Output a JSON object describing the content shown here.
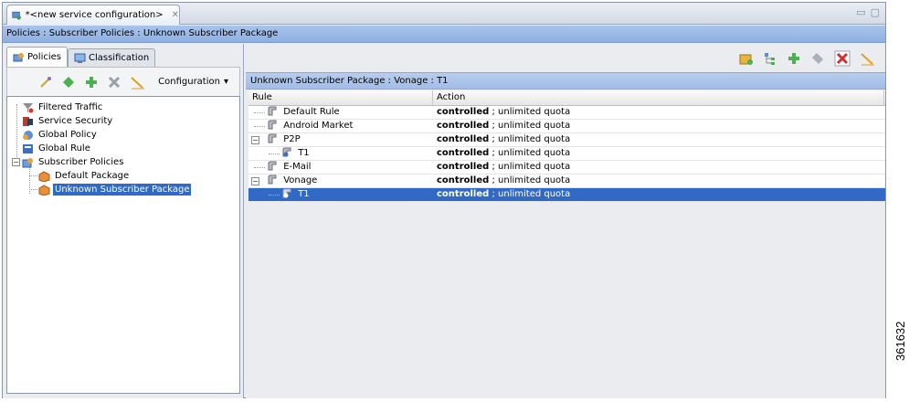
{
  "window": {
    "tab_title": "*<new service configuration>",
    "tab_close": "✕",
    "minimize": "▭",
    "maximize": "▢"
  },
  "breadcrumb": "Policies : Subscriber Policies : Unknown Subscriber Package",
  "left_panel": {
    "tabs": [
      {
        "label": "Policies",
        "icon": "policies-icon"
      },
      {
        "label": "Classification",
        "icon": "classification-icon"
      }
    ],
    "toolbar": {
      "configuration_label": "Configuration",
      "configuration_arrow": "▾"
    },
    "tree": [
      {
        "label": "Filtered Traffic",
        "icon": "filtered-traffic-icon"
      },
      {
        "label": "Service Security",
        "icon": "service-security-icon"
      },
      {
        "label": "Global Policy",
        "icon": "global-policy-icon"
      },
      {
        "label": "Global Rule",
        "icon": "global-rule-icon"
      },
      {
        "label": "Subscriber Policies",
        "icon": "subscriber-policies-icon",
        "expander": "−"
      },
      {
        "label": "Default Package",
        "icon": "package-icon"
      },
      {
        "label": "Unknown Subscriber Package",
        "icon": "package-icon",
        "selected": true
      }
    ]
  },
  "right_panel": {
    "header": "Unknown Subscriber Package : Vonage : T1",
    "columns": [
      "Rule",
      "Action"
    ],
    "rows": [
      {
        "rule": "Default Rule",
        "action_bold": "controlled",
        "action_rest": " ; unlimited quota"
      },
      {
        "rule": "Android Market",
        "action_bold": "controlled",
        "action_rest": " ; unlimited quota"
      },
      {
        "rule": "P2P",
        "action_bold": "controlled",
        "action_rest": " ; unlimited quota",
        "expander": "−"
      },
      {
        "rule": "T1",
        "action_bold": "controlled",
        "action_rest": " ; unlimited quota"
      },
      {
        "rule": "E-Mail",
        "action_bold": "controlled",
        "action_rest": " ; unlimited quota"
      },
      {
        "rule": "Vonage",
        "action_bold": "controlled",
        "action_rest": " ; unlimited quota",
        "expander": "−"
      },
      {
        "rule": "T1",
        "action_bold": "controlled",
        "action_rest": " ; unlimited quota",
        "selected": true
      }
    ]
  },
  "figure_id": "361632",
  "colors": {
    "selection": "#316ac5",
    "breadcrumb_bg": "#9bb9e6"
  }
}
